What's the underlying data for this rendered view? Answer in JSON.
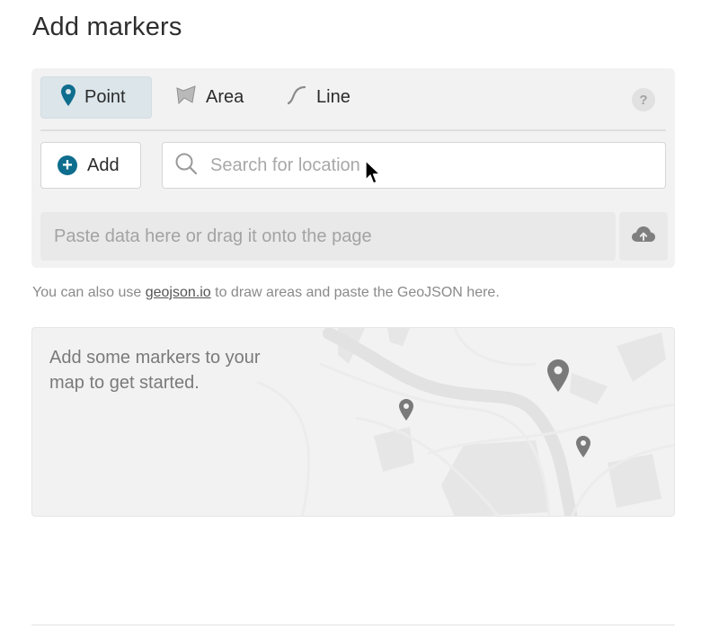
{
  "page": {
    "title": "Add markers"
  },
  "tabs": [
    {
      "label": "Point",
      "icon": "map-pin-icon",
      "active": true
    },
    {
      "label": "Area",
      "icon": "polygon-icon",
      "active": false
    },
    {
      "label": "Line",
      "icon": "line-icon",
      "active": false
    }
  ],
  "help": {
    "label": "?"
  },
  "add_button": {
    "label": "Add",
    "icon": "plus-circle-icon"
  },
  "search": {
    "placeholder": "Search for location",
    "value": ""
  },
  "paste": {
    "placeholder": "Paste data here or drag it onto the page",
    "upload_icon": "cloud-upload-icon"
  },
  "hint": {
    "before": "You can also use ",
    "link": "geojson.io",
    "after": " to draw areas and paste the GeoJSON here."
  },
  "map": {
    "empty_text": "Add some markers to your map to get started."
  },
  "colors": {
    "accent": "#0f6d8e",
    "panel": "#f2f2f2",
    "active_tab": "#dbe5ea"
  }
}
